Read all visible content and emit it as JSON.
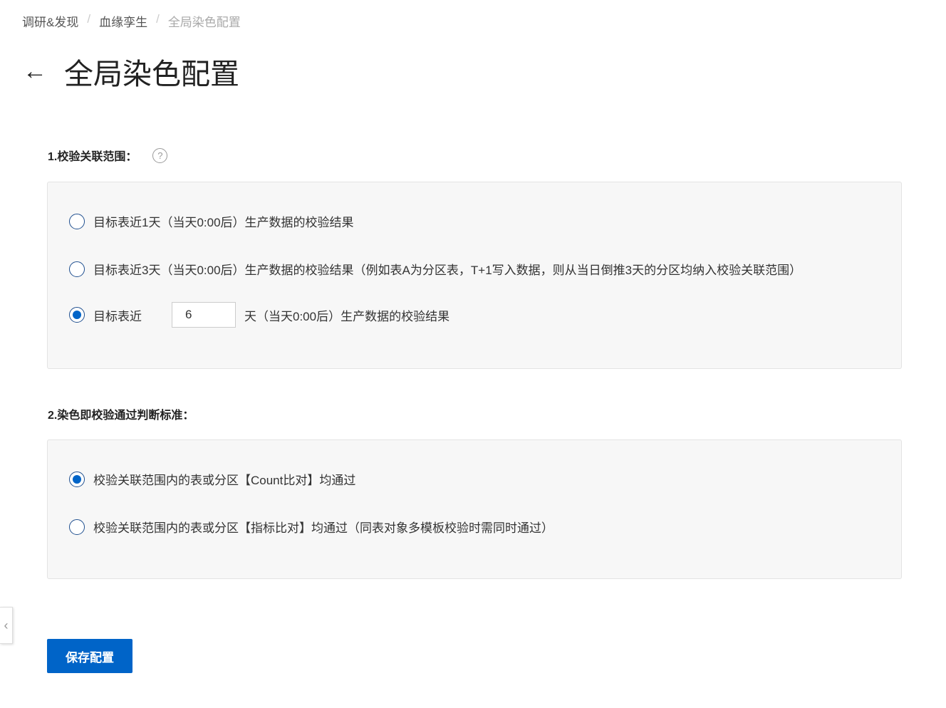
{
  "breadcrumb": [
    "调研&发现",
    "血缘孪生",
    "全局染色配置"
  ],
  "page_title": "全局染色配置",
  "section1": {
    "label": "1.校验关联范围：",
    "options": [
      {
        "label": "目标表近1天（当天0:00后）生产数据的校验结果",
        "checked": false
      },
      {
        "label": "目标表近3天（当天0:00后）生产数据的校验结果（例如表A为分区表，T+1写入数据，则从当日倒推3天的分区均纳入校验关联范围）",
        "checked": false
      },
      {
        "label_prefix": "目标表近",
        "value": "6",
        "label_suffix": "天（当天0:00后）生产数据的校验结果",
        "checked": true
      }
    ]
  },
  "section2": {
    "label": "2.染色即校验通过判断标准：",
    "options": [
      {
        "label": "校验关联范围内的表或分区【Count比对】均通过",
        "checked": true
      },
      {
        "label": "校验关联范围内的表或分区【指标比对】均通过（同表对象多模板校验时需同时通过）",
        "checked": false
      }
    ]
  },
  "save_label": "保存配置",
  "colors": {
    "primary": "#0064c8"
  }
}
